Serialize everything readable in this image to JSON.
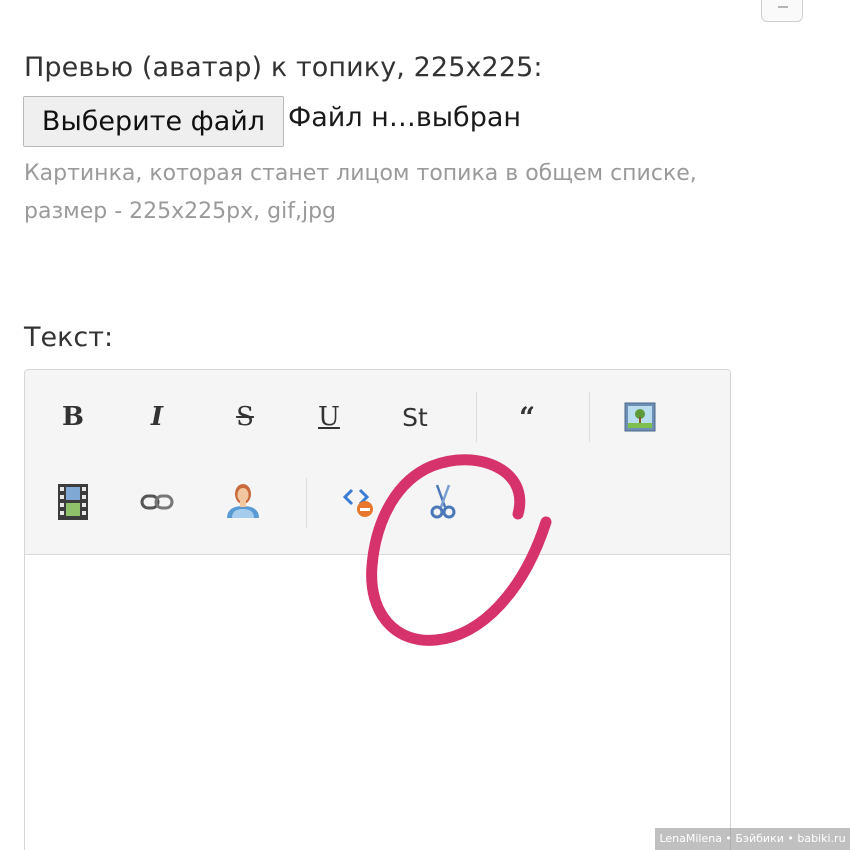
{
  "avatar": {
    "label": "Превью (аватар) к топику, 225x225:",
    "choose_file_button": "Выберите файл",
    "file_status": "Файл н…выбран",
    "hint": "Картинка, которая станет лицом топика в общем списке, размер - 225x225px, gif,jpg"
  },
  "editor": {
    "label": "Текст:",
    "toolbar": {
      "bold": "B",
      "italic": "I",
      "strikethrough": "S",
      "underline": "U",
      "style": "St",
      "quote": "“",
      "icons": [
        "image-icon",
        "video-icon",
        "link-icon",
        "user-icon",
        "code-icon",
        "cut-icon"
      ]
    },
    "content": ""
  },
  "annotation": {
    "color": "#d6336c"
  },
  "watermark": "LenaMilena • Бэйбики • babiki.ru"
}
